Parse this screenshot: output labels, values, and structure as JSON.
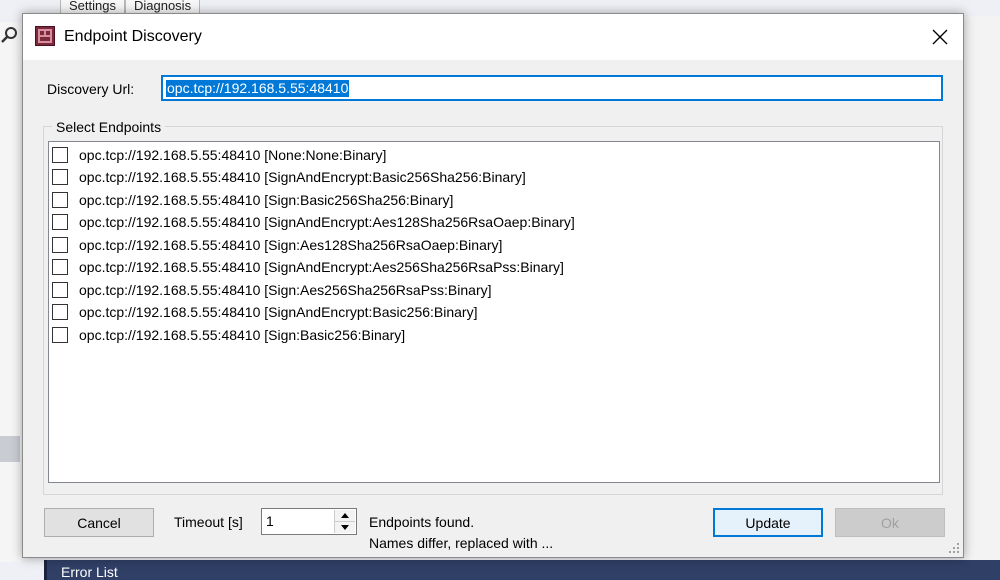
{
  "background": {
    "tabs": [
      "Settings",
      "Diagnosis"
    ],
    "bottom_panel_title": "Error List",
    "search_icon": "search-icon"
  },
  "dialog": {
    "title": "Endpoint Discovery",
    "app_icon": "app-icon",
    "close_icon": "close-icon",
    "discovery_url_label": "Discovery Url:",
    "discovery_url_value": "opc.tcp://192.168.5.55:48410",
    "select_endpoints_label": "Select Endpoints",
    "endpoints": [
      {
        "label": "opc.tcp://192.168.5.55:48410 [None:None:Binary]",
        "checked": false
      },
      {
        "label": "opc.tcp://192.168.5.55:48410 [SignAndEncrypt:Basic256Sha256:Binary]",
        "checked": false
      },
      {
        "label": "opc.tcp://192.168.5.55:48410 [Sign:Basic256Sha256:Binary]",
        "checked": false
      },
      {
        "label": "opc.tcp://192.168.5.55:48410 [SignAndEncrypt:Aes128Sha256RsaOaep:Binary]",
        "checked": false
      },
      {
        "label": "opc.tcp://192.168.5.55:48410 [Sign:Aes128Sha256RsaOaep:Binary]",
        "checked": false
      },
      {
        "label": "opc.tcp://192.168.5.55:48410 [SignAndEncrypt:Aes256Sha256RsaPss:Binary]",
        "checked": false
      },
      {
        "label": "opc.tcp://192.168.5.55:48410 [Sign:Aes256Sha256RsaPss:Binary]",
        "checked": false
      },
      {
        "label": "opc.tcp://192.168.5.55:48410 [SignAndEncrypt:Basic256:Binary]",
        "checked": false
      },
      {
        "label": "opc.tcp://192.168.5.55:48410 [Sign:Basic256:Binary]",
        "checked": false
      }
    ],
    "cancel_label": "Cancel",
    "timeout_label": "Timeout [s]",
    "timeout_value": "1",
    "status_line1": "Endpoints found.",
    "status_line2": "Names differ, replaced with ...",
    "update_label": "Update",
    "ok_label": "Ok",
    "colors": {
      "accent": "#0078d7",
      "dialog_bg": "#f0f0f0",
      "bottom_bar": "#2f3f66"
    }
  }
}
